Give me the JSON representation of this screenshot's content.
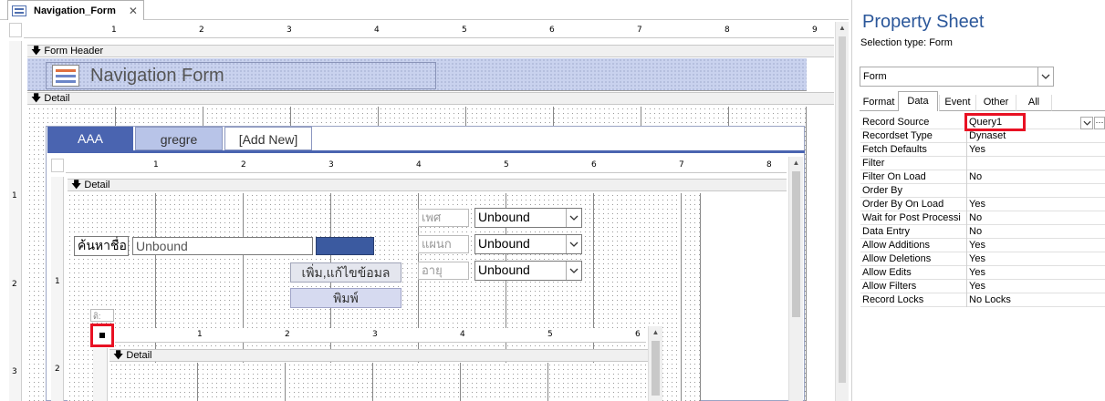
{
  "tab": {
    "title": "Navigation_Form",
    "close": "✕"
  },
  "form_header": {
    "section_label": "Form Header",
    "title": "Navigation Form"
  },
  "detail": {
    "section_label": "Detail"
  },
  "nav_tabs": [
    {
      "label": "AAA",
      "active": true
    },
    {
      "label": "gregre",
      "active": false
    },
    {
      "label": "[Add New]",
      "active": false
    }
  ],
  "subform": {
    "section_label": "Detail",
    "search_label": "ค้นหาชื่อ",
    "search_value": "Unbound",
    "edit_button": "เพิ่ม,แก้ไขข้อมล",
    "print_button": "พิมพ์",
    "combo_labels": [
      "เพศ",
      "แผนก",
      "อายุ"
    ],
    "combo_values": [
      "Unbound",
      "Unbound",
      "Unbound"
    ],
    "small_label": "ติ:"
  },
  "inner_subform": {
    "section_label": "Detail"
  },
  "outer_ruler": [
    "1",
    "2",
    "3",
    "4",
    "5",
    "6",
    "7",
    "8",
    "9"
  ],
  "sub_ruler": [
    "1",
    "2",
    "3",
    "4",
    "5",
    "6",
    "7",
    "8"
  ],
  "inner_ruler": [
    "1",
    "2",
    "3",
    "4",
    "5",
    "6"
  ],
  "left_ruler": [
    "1",
    "2",
    "3"
  ],
  "property_sheet": {
    "title": "Property Sheet",
    "selection_type": "Selection type:  Form",
    "selected_object": "Form",
    "tabs": [
      "Format",
      "Data",
      "Event",
      "Other",
      "All"
    ],
    "active_tab": "Data",
    "rows": [
      {
        "name": "Record Source",
        "value": "Query1"
      },
      {
        "name": "Recordset Type",
        "value": "Dynaset"
      },
      {
        "name": "Fetch Defaults",
        "value": "Yes"
      },
      {
        "name": "Filter",
        "value": ""
      },
      {
        "name": "Filter On Load",
        "value": "No"
      },
      {
        "name": "Order By",
        "value": ""
      },
      {
        "name": "Order By On Load",
        "value": "Yes"
      },
      {
        "name": "Wait for Post Processi",
        "value": "No"
      },
      {
        "name": "Data Entry",
        "value": "No"
      },
      {
        "name": "Allow Additions",
        "value": "Yes"
      },
      {
        "name": "Allow Deletions",
        "value": "Yes"
      },
      {
        "name": "Allow Edits",
        "value": "Yes"
      },
      {
        "name": "Allow Filters",
        "value": "Yes"
      },
      {
        "name": "Record Locks",
        "value": "No Locks"
      }
    ]
  },
  "colors": {
    "nav_active": "#4a64b0",
    "nav_inactive": "#b8c4e8",
    "highlight": "#e81123",
    "header_band": "#c9d2ee"
  }
}
